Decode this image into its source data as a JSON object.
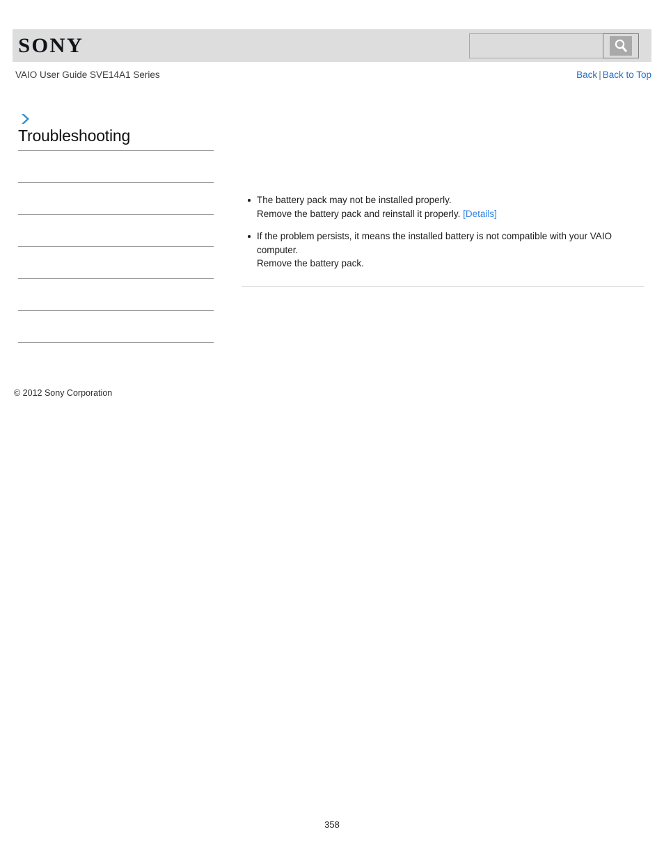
{
  "header": {
    "logo_text": "SONY",
    "search": {
      "value": "",
      "placeholder": "",
      "icon": "search-icon",
      "button_label": ""
    }
  },
  "subheader": {
    "guide_title": "VAIO User Guide SVE14A1 Series",
    "links": {
      "back": "Back",
      "separator": "|",
      "back_to_top": "Back to Top"
    }
  },
  "sidebar": {
    "breadcrumb_icon": "chevron-right-icon",
    "section_title": "Troubleshooting",
    "items": [
      {
        "label": ""
      },
      {
        "label": ""
      },
      {
        "label": ""
      },
      {
        "label": ""
      },
      {
        "label": ""
      },
      {
        "label": ""
      }
    ]
  },
  "main": {
    "bullets": [
      {
        "line1": "The battery pack may not be installed properly.",
        "line2": "Remove the battery pack and reinstall it properly.",
        "link": "[Details]"
      },
      {
        "line1": "If the problem persists, it means the installed battery is not compatible with your VAIO computer.",
        "line2": "Remove the battery pack.",
        "link": ""
      }
    ]
  },
  "footer": {
    "copyright": "© 2012 Sony Corporation",
    "page_number": "358"
  },
  "colors": {
    "link_blue": "#1f6fd0",
    "details_blue": "#2f80e0",
    "accent_arrow": "#2f8fd0",
    "header_band": "#dddddd",
    "rule_gray": "#9a9a9a"
  }
}
